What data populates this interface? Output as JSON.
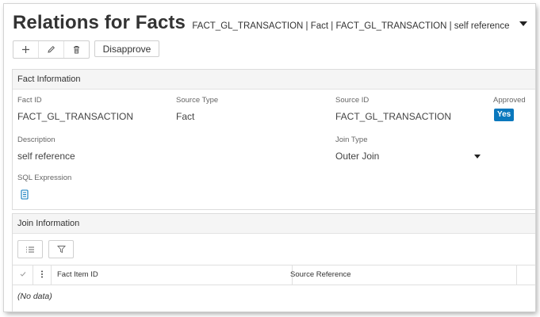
{
  "header": {
    "title": "Relations for Facts",
    "subtitle": "FACT_GL_TRANSACTION | Fact | FACT_GL_TRANSACTION | self reference"
  },
  "toolbar": {
    "add_icon": "plus-icon",
    "edit_icon": "pencil-icon",
    "delete_icon": "trash-icon",
    "disapprove_label": "Disapprove"
  },
  "fact_info": {
    "heading": "Fact Information",
    "fact_id_label": "Fact ID",
    "fact_id_value": "FACT_GL_TRANSACTION",
    "source_type_label": "Source Type",
    "source_type_value": "Fact",
    "source_id_label": "Source ID",
    "source_id_value": "FACT_GL_TRANSACTION",
    "approved_label": "Approved",
    "approved_value": "Yes",
    "description_label": "Description",
    "description_value": "self reference",
    "join_type_label": "Join Type",
    "join_type_value": "Outer Join",
    "sql_expression_label": "SQL Expression",
    "sql_icon": "document-icon"
  },
  "join_info": {
    "heading": "Join Information",
    "columns": [
      "Fact Item ID",
      "Source Reference"
    ],
    "empty_text": "(No data)"
  },
  "colors": {
    "accent": "#0a78bd",
    "panel_header_bg": "#f5f5f5",
    "border": "#dcdcdc"
  }
}
